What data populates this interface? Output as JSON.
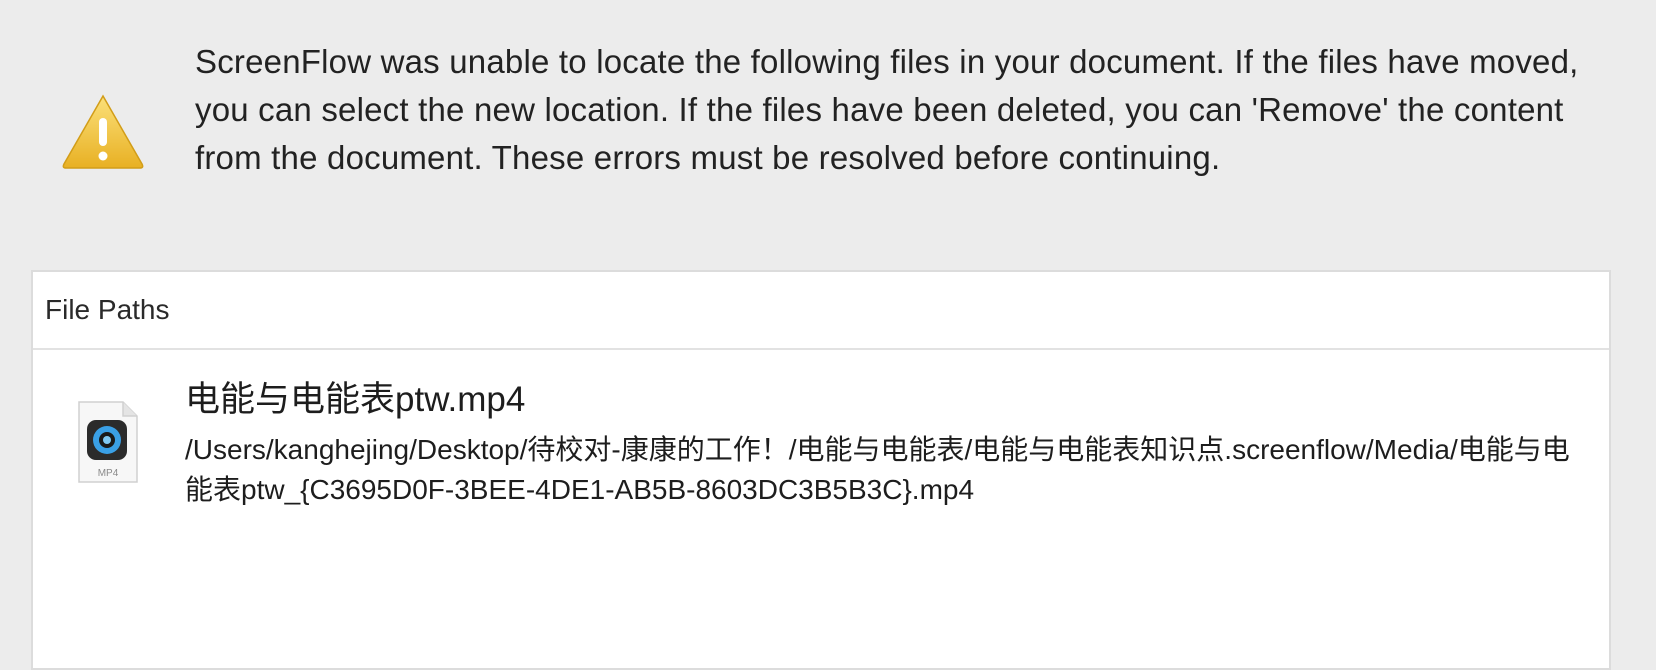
{
  "alert": {
    "icon": "warning-icon",
    "message": "ScreenFlow was unable to locate the following files in your document.  If the files have moved, you can select the new location.  If the files have been deleted, you can 'Remove' the content from the document.  These errors must be resolved before continuing."
  },
  "table": {
    "header": "File Paths",
    "rows": [
      {
        "icon": "mp4-file-icon",
        "icon_label": "MP4",
        "name": "电能与电能表ptw.mp4",
        "path": "/Users/kanghejing/Desktop/待校对-康康的工作！/电能与电能表/电能与电能表知识点.screenflow/Media/电能与电能表ptw_{C3695D0F-3BEE-4DE1-AB5B-8603DC3B5B3C}.mp4"
      }
    ]
  },
  "colors": {
    "background": "#ececec",
    "warning_yellow": "#f3c438",
    "table_background": "#ffffff"
  }
}
